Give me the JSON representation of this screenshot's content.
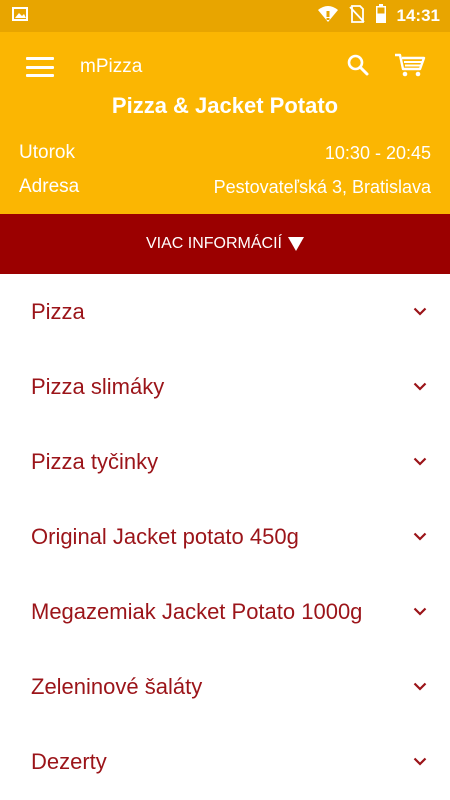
{
  "status_bar": {
    "time": "14:31",
    "icons": [
      "image-icon",
      "wifi-icon",
      "no-sim-icon",
      "battery-icon"
    ]
  },
  "toolbar": {
    "app_title": "mPizza",
    "menu_icon": "menu-icon",
    "search_icon": "search-icon",
    "cart_icon": "cart-icon"
  },
  "restaurant": {
    "name": "Pizza & Jacket Potato",
    "day_label": "Utorok",
    "hours": "10:30 - 20:45",
    "address_label": "Adresa",
    "address": "Pestovateľská 3, Bratislava"
  },
  "more_info": {
    "label": "VIAC INFORMÁCIÍ"
  },
  "categories": [
    {
      "label": "Pizza"
    },
    {
      "label": "Pizza slimáky"
    },
    {
      "label": "Pizza tyčinky"
    },
    {
      "label": "Original Jacket potato 450g"
    },
    {
      "label": "Megazemiak Jacket Potato 1000g"
    },
    {
      "label": "Zeleninové šaláty"
    },
    {
      "label": "Dezerty"
    }
  ],
  "colors": {
    "primary": "#fbb602",
    "status_bar": "#e8a500",
    "accent": "#9b0000",
    "category_text": "#9b1419"
  }
}
